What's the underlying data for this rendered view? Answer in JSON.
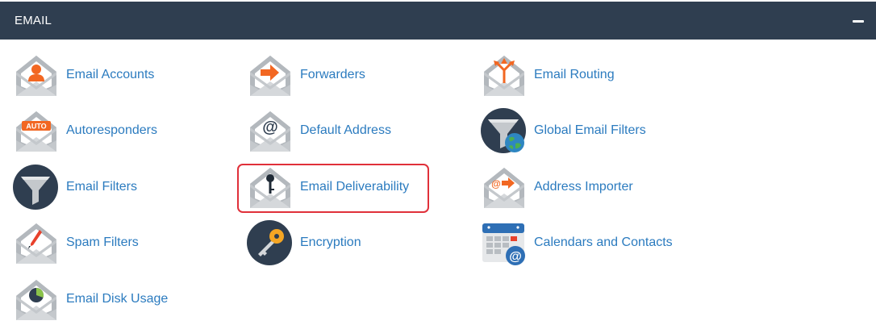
{
  "panel": {
    "title": "EMAIL",
    "collapse_icon": "minus-icon"
  },
  "tools": [
    {
      "id": "email-accounts",
      "label": "Email Accounts",
      "icon": "envelope-user-icon"
    },
    {
      "id": "forwarders",
      "label": "Forwarders",
      "icon": "envelope-arrow-icon"
    },
    {
      "id": "email-routing",
      "label": "Email Routing",
      "icon": "envelope-routing-icon"
    },
    {
      "id": "autoresponders",
      "label": "Autoresponders",
      "icon": "envelope-auto-icon",
      "badge": "AUTO"
    },
    {
      "id": "default-address",
      "label": "Default Address",
      "icon": "envelope-at-icon"
    },
    {
      "id": "global-email-filters",
      "label": "Global Email Filters",
      "icon": "funnel-globe-icon"
    },
    {
      "id": "email-filters",
      "label": "Email Filters",
      "icon": "funnel-icon"
    },
    {
      "id": "email-deliverability",
      "label": "Email Deliverability",
      "icon": "envelope-key-icon",
      "highlighted": true
    },
    {
      "id": "address-importer",
      "label": "Address Importer",
      "icon": "envelope-import-icon"
    },
    {
      "id": "spam-filters",
      "label": "Spam Filters",
      "icon": "envelope-pen-icon"
    },
    {
      "id": "encryption",
      "label": "Encryption",
      "icon": "key-icon"
    },
    {
      "id": "calendars-and-contacts",
      "label": "Calendars and Contacts",
      "icon": "calendar-at-icon"
    },
    {
      "id": "email-disk-usage",
      "label": "Email Disk Usage",
      "icon": "envelope-piechart-icon"
    }
  ],
  "colors": {
    "header_bg": "#2f3e50",
    "link": "#2b7bbf",
    "accent_orange": "#f26722",
    "highlight_border": "#e0303a",
    "envelope_gray": "#bfc4c8",
    "dark_circle": "#2f3e50"
  }
}
